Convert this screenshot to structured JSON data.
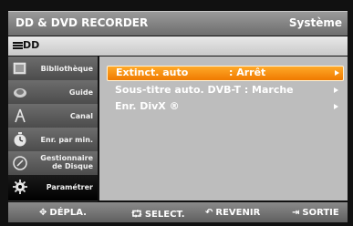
{
  "header": {
    "title": "DD & DVD RECORDER",
    "section": "Système"
  },
  "subheader": {
    "label": "DD"
  },
  "sidebar": {
    "items": [
      {
        "label": "Bibliothèque",
        "icon": "library-icon"
      },
      {
        "label": "Guide",
        "icon": "guide-icon"
      },
      {
        "label": "Canal",
        "icon": "antenna-icon"
      },
      {
        "label": "Enr. par min.",
        "icon": "timer-icon"
      },
      {
        "label_line1": "Gestionnaire",
        "label_line2": "de Disque",
        "icon": "disc-manager-icon"
      },
      {
        "label": "Paramétrer",
        "icon": "settings-icon"
      }
    ]
  },
  "menu": {
    "items": [
      {
        "label": "Extinct. auto",
        "value": ": Arrêt",
        "selected": true
      },
      {
        "label": "Sous-titre auto. DVB-T : Marche",
        "value": "",
        "selected": false
      },
      {
        "label": "Enr. DivX ®",
        "value": "",
        "selected": false
      }
    ]
  },
  "footer": {
    "move": "DÉPLA.",
    "select": "SELECT.",
    "back": "REVENIR",
    "exit": "SORTIE"
  },
  "colors": {
    "highlight": "#f08a00",
    "panel": "#bdbdbd",
    "sidebar_active": "#000000"
  }
}
